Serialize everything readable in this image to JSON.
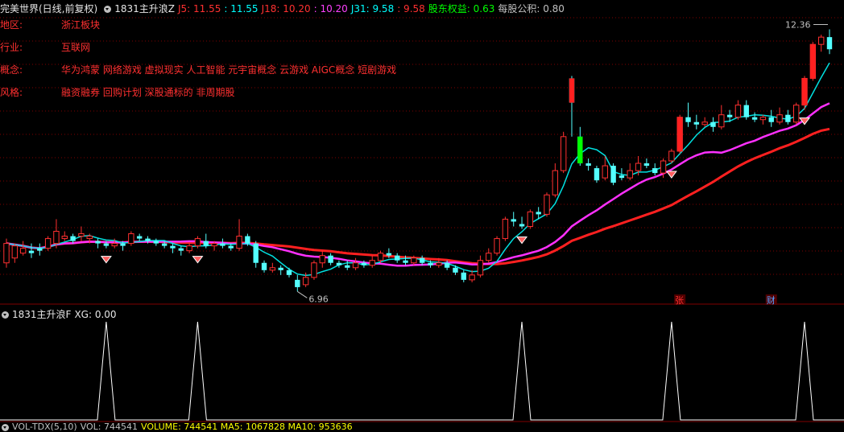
{
  "header": {
    "stock_title": "完美世界(日线,前复权)",
    "indicator_name": "1831主升浪Z",
    "values": [
      {
        "label": "J5: 11.55",
        "color": "#ff3030"
      },
      {
        "label": ": 11.55",
        "color": "#00ffff"
      },
      {
        "label": "J18: 10.20",
        "color": "#ff3030"
      },
      {
        "label": ": 10.20",
        "color": "#ff40ff"
      },
      {
        "label": "J31: 9.58",
        "color": "#00ffff"
      },
      {
        "label": ": 9.58",
        "color": "#ff3030"
      },
      {
        "label": "股东权益: 0.63",
        "color": "#00ff00"
      },
      {
        "label": "每股公积: 0.80",
        "color": "#c0c0c0"
      }
    ]
  },
  "info": [
    {
      "key": "地区:",
      "value": "浙江板块"
    },
    {
      "key": "行业:",
      "value": "互联网"
    },
    {
      "key": "概念:",
      "value": "华为鸿蒙 网络游戏 虚拟现实 人工智能 元宇宙概念 云游戏 AIGC概念 短剧游戏"
    },
    {
      "key": "风格:",
      "value": "融资融券 回购计划 深股通标的 非周期股"
    }
  ],
  "chart": {
    "high_label": "12.36",
    "low_label": "6.96",
    "markers": [
      "张",
      "财"
    ]
  },
  "sub_panel": {
    "name": "1831主升浪F",
    "value": "XG: 0.00"
  },
  "volume_panel": {
    "name": "VOL-TDX(5,10)",
    "value": "VOL: 744541",
    "extra": "VOLUME: 744541  MA5: 1067828  MA10: 953636"
  },
  "chart_data": {
    "type": "candlestick",
    "candles": [
      [
        7.55,
        7.95,
        7.45,
        8.05
      ],
      [
        7.65,
        7.9,
        7.55,
        7.95
      ],
      [
        7.75,
        7.85,
        7.7,
        8.0
      ],
      [
        7.8,
        7.75,
        7.65,
        7.95
      ],
      [
        7.85,
        7.8,
        7.7,
        7.95
      ],
      [
        7.85,
        8.05,
        7.8,
        8.1
      ],
      [
        7.95,
        8.2,
        7.85,
        8.45
      ],
      [
        8.05,
        8.1,
        8.0,
        8.2
      ],
      [
        8.1,
        8.0,
        7.95,
        8.15
      ],
      [
        8.1,
        8.15,
        8.0,
        8.3
      ],
      [
        8.05,
        8.1,
        7.95,
        8.15
      ],
      [
        8.0,
        7.95,
        7.85,
        8.05
      ],
      [
        7.95,
        7.9,
        7.85,
        8.0
      ],
      [
        7.9,
        7.95,
        7.85,
        8.05
      ],
      [
        7.95,
        7.9,
        7.8,
        8.0
      ],
      [
        7.95,
        8.15,
        7.9,
        8.2
      ],
      [
        8.1,
        8.05,
        8.0,
        8.15
      ],
      [
        8.05,
        8.0,
        7.95,
        8.1
      ],
      [
        8.0,
        7.95,
        7.9,
        8.05
      ],
      [
        7.95,
        7.9,
        7.85,
        8.0
      ],
      [
        7.9,
        7.85,
        7.75,
        7.95
      ],
      [
        7.85,
        7.8,
        7.7,
        7.9
      ],
      [
        7.8,
        7.9,
        7.75,
        7.95
      ],
      [
        7.9,
        8.05,
        7.85,
        8.1
      ],
      [
        8.0,
        7.9,
        7.85,
        8.15
      ],
      [
        7.9,
        7.95,
        7.8,
        8.0
      ],
      [
        7.95,
        7.9,
        7.85,
        8.05
      ],
      [
        7.9,
        7.85,
        7.8,
        7.95
      ],
      [
        7.85,
        8.1,
        7.8,
        8.45
      ],
      [
        8.1,
        7.95,
        7.9,
        8.15
      ],
      [
        7.95,
        7.55,
        7.45,
        8.0
      ],
      [
        7.55,
        7.4,
        7.35,
        7.6
      ],
      [
        7.4,
        7.45,
        7.35,
        7.55
      ],
      [
        7.45,
        7.4,
        7.3,
        7.5
      ],
      [
        7.4,
        7.3,
        7.25,
        7.45
      ],
      [
        7.2,
        7.05,
        6.96,
        7.3
      ],
      [
        7.1,
        7.25,
        7.05,
        7.35
      ],
      [
        7.25,
        7.55,
        7.2,
        7.6
      ],
      [
        7.55,
        7.7,
        7.45,
        7.8
      ],
      [
        7.7,
        7.55,
        7.5,
        7.75
      ],
      [
        7.55,
        7.5,
        7.45,
        7.6
      ],
      [
        7.5,
        7.45,
        7.4,
        7.6
      ],
      [
        7.45,
        7.55,
        7.4,
        7.65
      ],
      [
        7.55,
        7.5,
        7.45,
        7.6
      ],
      [
        7.5,
        7.6,
        7.45,
        7.7
      ],
      [
        7.6,
        7.75,
        7.55,
        7.8
      ],
      [
        7.75,
        7.7,
        7.65,
        7.85
      ],
      [
        7.7,
        7.6,
        7.55,
        7.75
      ],
      [
        7.6,
        7.55,
        7.5,
        7.7
      ],
      [
        7.55,
        7.65,
        7.5,
        7.7
      ],
      [
        7.65,
        7.55,
        7.5,
        7.7
      ],
      [
        7.55,
        7.5,
        7.45,
        7.6
      ],
      [
        7.5,
        7.55,
        7.45,
        7.65
      ],
      [
        7.55,
        7.45,
        7.4,
        7.6
      ],
      [
        7.45,
        7.35,
        7.3,
        7.5
      ],
      [
        7.35,
        7.2,
        7.15,
        7.4
      ],
      [
        7.2,
        7.3,
        7.15,
        7.4
      ],
      [
        7.3,
        7.6,
        7.25,
        7.7
      ],
      [
        7.6,
        7.75,
        7.55,
        7.85
      ],
      [
        7.75,
        8.05,
        7.7,
        8.1
      ],
      [
        8.05,
        8.45,
        8.0,
        8.5
      ],
      [
        8.45,
        8.4,
        8.3,
        8.6
      ],
      [
        8.35,
        8.3,
        8.25,
        8.5
      ],
      [
        8.3,
        8.6,
        8.25,
        8.65
      ],
      [
        8.6,
        8.55,
        8.45,
        8.7
      ],
      [
        8.55,
        8.95,
        8.5,
        9.0
      ],
      [
        8.95,
        9.45,
        8.9,
        9.6
      ],
      [
        9.45,
        10.15,
        9.4,
        10.25
      ],
      [
        11.35,
        10.85,
        10.15,
        11.4
      ],
      [
        10.15,
        9.6,
        9.55,
        10.35
      ],
      [
        9.6,
        9.55,
        9.45,
        9.7
      ],
      [
        9.5,
        9.25,
        9.2,
        9.55
      ],
      [
        9.3,
        9.55,
        9.25,
        9.75
      ],
      [
        9.55,
        9.2,
        9.15,
        9.6
      ],
      [
        9.35,
        9.3,
        9.25,
        9.5
      ],
      [
        9.3,
        9.45,
        9.25,
        9.6
      ],
      [
        9.45,
        9.6,
        9.35,
        9.75
      ],
      [
        9.6,
        9.55,
        9.5,
        9.7
      ],
      [
        9.5,
        9.4,
        9.35,
        9.6
      ],
      [
        9.4,
        9.65,
        9.3,
        9.7
      ],
      [
        9.65,
        9.85,
        9.6,
        9.9
      ],
      [
        9.85,
        10.55,
        9.8,
        10.6
      ],
      [
        10.55,
        10.45,
        10.35,
        10.85
      ],
      [
        10.45,
        10.4,
        10.3,
        10.6
      ],
      [
        10.4,
        10.45,
        10.35,
        10.55
      ],
      [
        10.45,
        10.35,
        10.25,
        10.55
      ],
      [
        10.35,
        10.6,
        10.3,
        10.8
      ],
      [
        10.6,
        10.55,
        10.45,
        10.7
      ],
      [
        10.55,
        10.8,
        10.5,
        10.9
      ],
      [
        10.8,
        10.55,
        10.5,
        10.9
      ],
      [
        10.55,
        10.5,
        10.45,
        10.65
      ],
      [
        10.5,
        10.55,
        10.4,
        10.6
      ],
      [
        10.55,
        10.45,
        10.35,
        10.7
      ],
      [
        10.45,
        10.6,
        10.4,
        10.75
      ],
      [
        10.6,
        10.45,
        10.4,
        10.7
      ],
      [
        10.45,
        10.8,
        10.4,
        10.85
      ],
      [
        10.8,
        11.35,
        10.7,
        11.4
      ],
      [
        11.35,
        12.05,
        11.3,
        12.1
      ],
      [
        12.05,
        12.2,
        11.9,
        12.25
      ],
      [
        12.2,
        11.95,
        11.85,
        12.36
      ]
    ],
    "ma_lines": [
      {
        "name": "J5",
        "color": "#00ffff"
      },
      {
        "name": "J18",
        "color": "#ff40ff"
      },
      {
        "name": "J31",
        "color": "#ff3030"
      }
    ],
    "xg_signals": [
      12,
      23,
      62,
      80,
      96
    ],
    "y_range": [
      6.8,
      12.6
    ]
  }
}
